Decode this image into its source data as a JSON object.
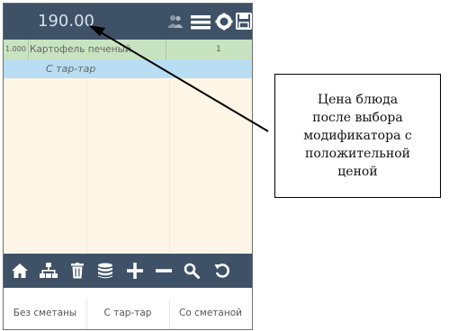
{
  "header": {
    "total": "190.00",
    "icons": [
      "people-icon",
      "menu-icon",
      "gear-icon",
      "save-icon"
    ]
  },
  "order": {
    "items": [
      {
        "qty": "1.000",
        "name": "Картофель печеный",
        "count": "1"
      }
    ],
    "modifier": "С тар-тар"
  },
  "toolbar": {
    "icons": [
      "home-icon",
      "hierarchy-icon",
      "trash-icon",
      "database-icon",
      "plus-icon",
      "minus-icon",
      "search-icon",
      "undo-icon"
    ]
  },
  "modifiers": {
    "buttons": [
      "Без сметаны",
      "С тар-тар",
      "Со сметаной"
    ]
  },
  "callout": {
    "lines": [
      "Цена блюда",
      "после выбора",
      "модификатора с",
      "положительной",
      "ценой"
    ]
  },
  "colors": {
    "bar_bg": "#3e5166",
    "order_row_bg": "#c8e3c0",
    "modifier_row_bg": "#b9ddf2",
    "content_bg": "#fdf5e6"
  }
}
